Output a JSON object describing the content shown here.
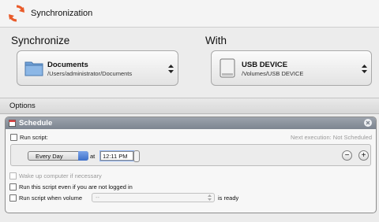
{
  "window": {
    "title": "Synchronization"
  },
  "synchronize": {
    "label": "Synchronize",
    "source": {
      "name": "Documents",
      "path": "/Users/administrator/Documents"
    }
  },
  "with": {
    "label": "With",
    "target": {
      "name": "USB DEVICE",
      "path": "/Volumes/USB DEVICE"
    }
  },
  "options": {
    "label": "Options"
  },
  "schedule": {
    "title": "Schedule",
    "run_script_label": "Run script:",
    "next_execution_label": "Next execution:",
    "next_execution_value": "Not Scheduled",
    "frequency": "Every Day",
    "at_label": "at",
    "time": "12:11 PM",
    "minus": "−",
    "plus": "+",
    "wake_label": "Wake up computer if necessary",
    "not_logged_label": "Run this script even if you are not logged in",
    "volume_label": "Run script when volume",
    "volume_placeholder": "--",
    "is_ready_label": "is ready"
  },
  "colors": {
    "accent": "#e95b2a",
    "header": "#8a919b",
    "select": "#3e6fc9"
  }
}
